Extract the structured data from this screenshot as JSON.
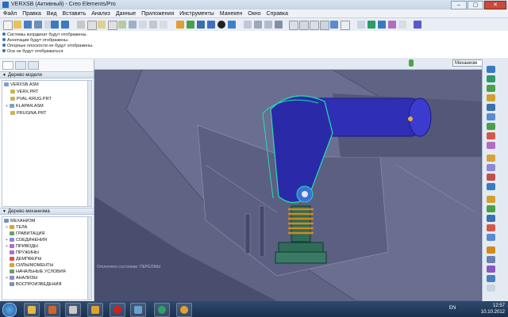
{
  "window": {
    "title": "VERXSB (Активный) - Creo Elements/Pro"
  },
  "menu": [
    "Файл",
    "Правка",
    "Вид",
    "Вставить",
    "Анализ",
    "Данные",
    "Приложения",
    "Инструменты",
    "Манекен",
    "Окно",
    "Справка"
  ],
  "messages": [
    "Системы координат будут отображены.",
    "Аннотации будут отображены.",
    "Опорные плоскости не будут отображены.",
    "Оси не будут отображаться."
  ],
  "filter": {
    "selected": "Механизм"
  },
  "model_tree": {
    "title": "Дерево модели",
    "items": [
      "VERXSB.ASM",
      "VERX.PRT",
      "PVAL-KRUG.PRT",
      "KLAPAN.ASM",
      "PRUGINA.PRT"
    ]
  },
  "mech_tree": {
    "title": "Дерево механизма",
    "items": [
      "МЕХАНИЗМ",
      "ТЕЛА",
      "ГРАВИТАЦИЯ",
      "СОЕДИНЕНИЯ",
      "ПРИВОДЫ",
      "ПРУЖИНЫ",
      "ДЕМПФЕРЫ",
      "СИЛЫ/МОМЕНТЫ",
      "НАЧАЛЬНЫЕ УСЛОВИЯ",
      "АНАЛИЗЫ",
      "ВОСПРОИЗВЕДЕНИЯ"
    ]
  },
  "viewport": {
    "label": "Отключено состояние: ПЕРЕОМЫ"
  },
  "taskbar": {
    "language": "EN",
    "time": "12:57",
    "date": "10.10.2012"
  },
  "colors": {
    "viewport_bg": "#5f6484",
    "part_blue": "#2f2fb5",
    "spring_orange": "#d08a1e",
    "valve_green": "#2f6b57"
  },
  "icons": [
    "start-icon",
    "folder-icon",
    "creo-icon",
    "opera-icon",
    "chrome-icon"
  ]
}
